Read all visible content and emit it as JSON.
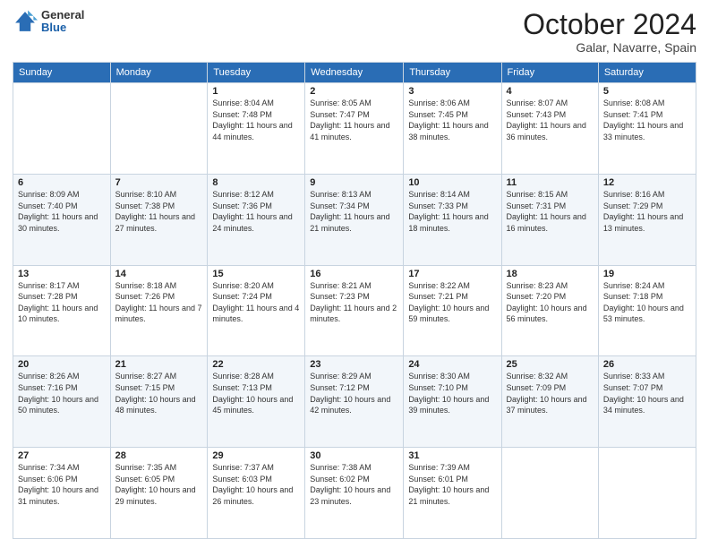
{
  "header": {
    "logo": {
      "general": "General",
      "blue": "Blue"
    },
    "title": "October 2024",
    "subtitle": "Galar, Navarre, Spain"
  },
  "days_of_week": [
    "Sunday",
    "Monday",
    "Tuesday",
    "Wednesday",
    "Thursday",
    "Friday",
    "Saturday"
  ],
  "weeks": [
    [
      {
        "num": "",
        "info": ""
      },
      {
        "num": "",
        "info": ""
      },
      {
        "num": "1",
        "info": "Sunrise: 8:04 AM\nSunset: 7:48 PM\nDaylight: 11 hours and 44 minutes."
      },
      {
        "num": "2",
        "info": "Sunrise: 8:05 AM\nSunset: 7:47 PM\nDaylight: 11 hours and 41 minutes."
      },
      {
        "num": "3",
        "info": "Sunrise: 8:06 AM\nSunset: 7:45 PM\nDaylight: 11 hours and 38 minutes."
      },
      {
        "num": "4",
        "info": "Sunrise: 8:07 AM\nSunset: 7:43 PM\nDaylight: 11 hours and 36 minutes."
      },
      {
        "num": "5",
        "info": "Sunrise: 8:08 AM\nSunset: 7:41 PM\nDaylight: 11 hours and 33 minutes."
      }
    ],
    [
      {
        "num": "6",
        "info": "Sunrise: 8:09 AM\nSunset: 7:40 PM\nDaylight: 11 hours and 30 minutes."
      },
      {
        "num": "7",
        "info": "Sunrise: 8:10 AM\nSunset: 7:38 PM\nDaylight: 11 hours and 27 minutes."
      },
      {
        "num": "8",
        "info": "Sunrise: 8:12 AM\nSunset: 7:36 PM\nDaylight: 11 hours and 24 minutes."
      },
      {
        "num": "9",
        "info": "Sunrise: 8:13 AM\nSunset: 7:34 PM\nDaylight: 11 hours and 21 minutes."
      },
      {
        "num": "10",
        "info": "Sunrise: 8:14 AM\nSunset: 7:33 PM\nDaylight: 11 hours and 18 minutes."
      },
      {
        "num": "11",
        "info": "Sunrise: 8:15 AM\nSunset: 7:31 PM\nDaylight: 11 hours and 16 minutes."
      },
      {
        "num": "12",
        "info": "Sunrise: 8:16 AM\nSunset: 7:29 PM\nDaylight: 11 hours and 13 minutes."
      }
    ],
    [
      {
        "num": "13",
        "info": "Sunrise: 8:17 AM\nSunset: 7:28 PM\nDaylight: 11 hours and 10 minutes."
      },
      {
        "num": "14",
        "info": "Sunrise: 8:18 AM\nSunset: 7:26 PM\nDaylight: 11 hours and 7 minutes."
      },
      {
        "num": "15",
        "info": "Sunrise: 8:20 AM\nSunset: 7:24 PM\nDaylight: 11 hours and 4 minutes."
      },
      {
        "num": "16",
        "info": "Sunrise: 8:21 AM\nSunset: 7:23 PM\nDaylight: 11 hours and 2 minutes."
      },
      {
        "num": "17",
        "info": "Sunrise: 8:22 AM\nSunset: 7:21 PM\nDaylight: 10 hours and 59 minutes."
      },
      {
        "num": "18",
        "info": "Sunrise: 8:23 AM\nSunset: 7:20 PM\nDaylight: 10 hours and 56 minutes."
      },
      {
        "num": "19",
        "info": "Sunrise: 8:24 AM\nSunset: 7:18 PM\nDaylight: 10 hours and 53 minutes."
      }
    ],
    [
      {
        "num": "20",
        "info": "Sunrise: 8:26 AM\nSunset: 7:16 PM\nDaylight: 10 hours and 50 minutes."
      },
      {
        "num": "21",
        "info": "Sunrise: 8:27 AM\nSunset: 7:15 PM\nDaylight: 10 hours and 48 minutes."
      },
      {
        "num": "22",
        "info": "Sunrise: 8:28 AM\nSunset: 7:13 PM\nDaylight: 10 hours and 45 minutes."
      },
      {
        "num": "23",
        "info": "Sunrise: 8:29 AM\nSunset: 7:12 PM\nDaylight: 10 hours and 42 minutes."
      },
      {
        "num": "24",
        "info": "Sunrise: 8:30 AM\nSunset: 7:10 PM\nDaylight: 10 hours and 39 minutes."
      },
      {
        "num": "25",
        "info": "Sunrise: 8:32 AM\nSunset: 7:09 PM\nDaylight: 10 hours and 37 minutes."
      },
      {
        "num": "26",
        "info": "Sunrise: 8:33 AM\nSunset: 7:07 PM\nDaylight: 10 hours and 34 minutes."
      }
    ],
    [
      {
        "num": "27",
        "info": "Sunrise: 7:34 AM\nSunset: 6:06 PM\nDaylight: 10 hours and 31 minutes."
      },
      {
        "num": "28",
        "info": "Sunrise: 7:35 AM\nSunset: 6:05 PM\nDaylight: 10 hours and 29 minutes."
      },
      {
        "num": "29",
        "info": "Sunrise: 7:37 AM\nSunset: 6:03 PM\nDaylight: 10 hours and 26 minutes."
      },
      {
        "num": "30",
        "info": "Sunrise: 7:38 AM\nSunset: 6:02 PM\nDaylight: 10 hours and 23 minutes."
      },
      {
        "num": "31",
        "info": "Sunrise: 7:39 AM\nSunset: 6:01 PM\nDaylight: 10 hours and 21 minutes."
      },
      {
        "num": "",
        "info": ""
      },
      {
        "num": "",
        "info": ""
      }
    ]
  ]
}
